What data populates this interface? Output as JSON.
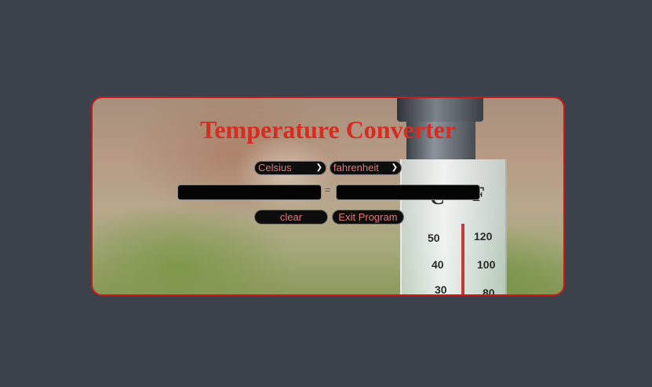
{
  "app": {
    "title": "Temperature Converter"
  },
  "converter": {
    "from_unit": "Celsius",
    "to_unit": "fahrenheit",
    "from_value": "",
    "to_value": "",
    "equals_sign": "="
  },
  "buttons": {
    "clear_label": "clear",
    "exit_label": "Exit Program"
  },
  "background_scale": {
    "celsius_marks": [
      "50",
      "40",
      "30"
    ],
    "fahrenheit_marks": [
      "120",
      "100",
      "80"
    ],
    "c_label": "C",
    "f_label": "F"
  },
  "colors": {
    "page_background": "#3b424b",
    "accent_red": "#d92b20",
    "border_red": "#c91a1a",
    "control_text": "#e07a7a",
    "control_background": "#0d0d0d"
  },
  "icons": {
    "dropdown": "chevron-down-icon"
  }
}
